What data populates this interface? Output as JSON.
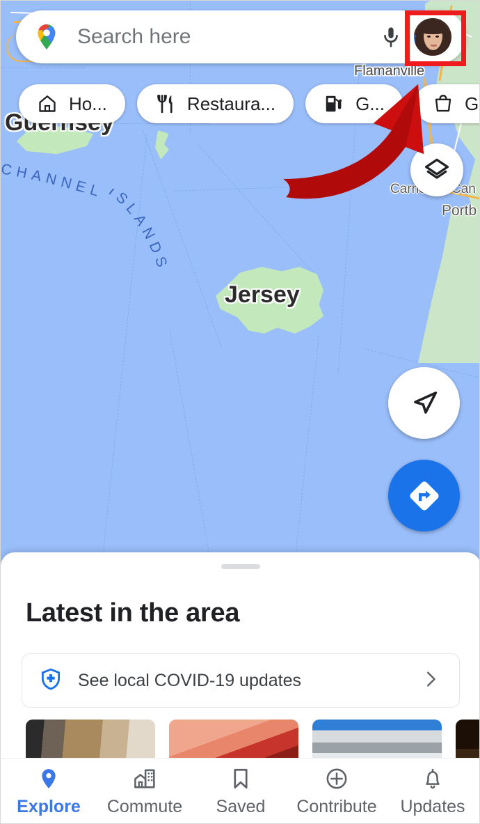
{
  "app": {
    "name": "Google Maps",
    "platform": "mobile"
  },
  "colors": {
    "accent_blue": "#1A73E8",
    "nav_active_blue": "#3B78E7",
    "water": "#9ABEFA",
    "land": "#CBE5C8",
    "island_land": "#C2E8BC",
    "road_yellow": "#F5B546",
    "annotation_red": "#EE1C1C",
    "map_label_dark": "#2B2B2B",
    "sea_label_blue": "#3A66BE",
    "text_primary": "#202124",
    "text_secondary": "#5F6368"
  },
  "search": {
    "placeholder": "Search here",
    "value": "",
    "logo_icon": "google-maps-pin-icon",
    "mic_icon": "microphone-icon",
    "avatar_icon": "account-avatar"
  },
  "annotation": {
    "type": "red-curved-arrow",
    "points_to": "account-avatar",
    "highlight_shape": "rectangle"
  },
  "chips": [
    {
      "label": "Ho...",
      "full_label": "Home",
      "icon": "home-icon"
    },
    {
      "label": "Restaura...",
      "full_label": "Restaurants",
      "icon": "restaurant-icon"
    },
    {
      "label": "G...",
      "full_label": "Gas",
      "icon": "gas-station-icon"
    },
    {
      "label": "Groc...",
      "full_label": "Groceries",
      "icon": "groceries-icon"
    }
  ],
  "map": {
    "labels": [
      {
        "text": "Guernsey",
        "kind": "island"
      },
      {
        "text": "Jersey",
        "kind": "island"
      },
      {
        "text": "Flamanville",
        "kind": "town"
      },
      {
        "text": "Carneville",
        "kind": "town"
      },
      {
        "text": "Can",
        "kind": "town"
      },
      {
        "text": "Portb",
        "kind": "town"
      }
    ],
    "sea_labels": [
      {
        "text": "CHANNEL"
      },
      {
        "text": "ISLANDS"
      }
    ],
    "buttons": [
      {
        "name": "layers-button",
        "icon": "layers-icon"
      },
      {
        "name": "my-location-button",
        "icon": "navigation-arrow-icon"
      },
      {
        "name": "directions-button",
        "icon": "directions-icon"
      }
    ]
  },
  "sheet": {
    "handle": "drag-handle",
    "title": "Latest in the area",
    "covid_card": {
      "label": "See local COVID-19 updates",
      "icon": "covid-shield-icon",
      "chevron": "chevron-right-icon"
    },
    "thumbnails": [
      {
        "name": "thumbnail-1"
      },
      {
        "name": "thumbnail-2"
      },
      {
        "name": "thumbnail-3"
      },
      {
        "name": "thumbnail-4"
      }
    ]
  },
  "bottom_nav": {
    "active": "Explore",
    "items": [
      {
        "label": "Explore",
        "icon": "map-pin-icon",
        "active": true
      },
      {
        "label": "Commute",
        "icon": "buildings-icon",
        "active": false
      },
      {
        "label": "Saved",
        "icon": "bookmark-icon",
        "active": false
      },
      {
        "label": "Contribute",
        "icon": "plus-circle-icon",
        "active": false
      },
      {
        "label": "Updates",
        "icon": "bell-icon",
        "active": false
      }
    ]
  }
}
